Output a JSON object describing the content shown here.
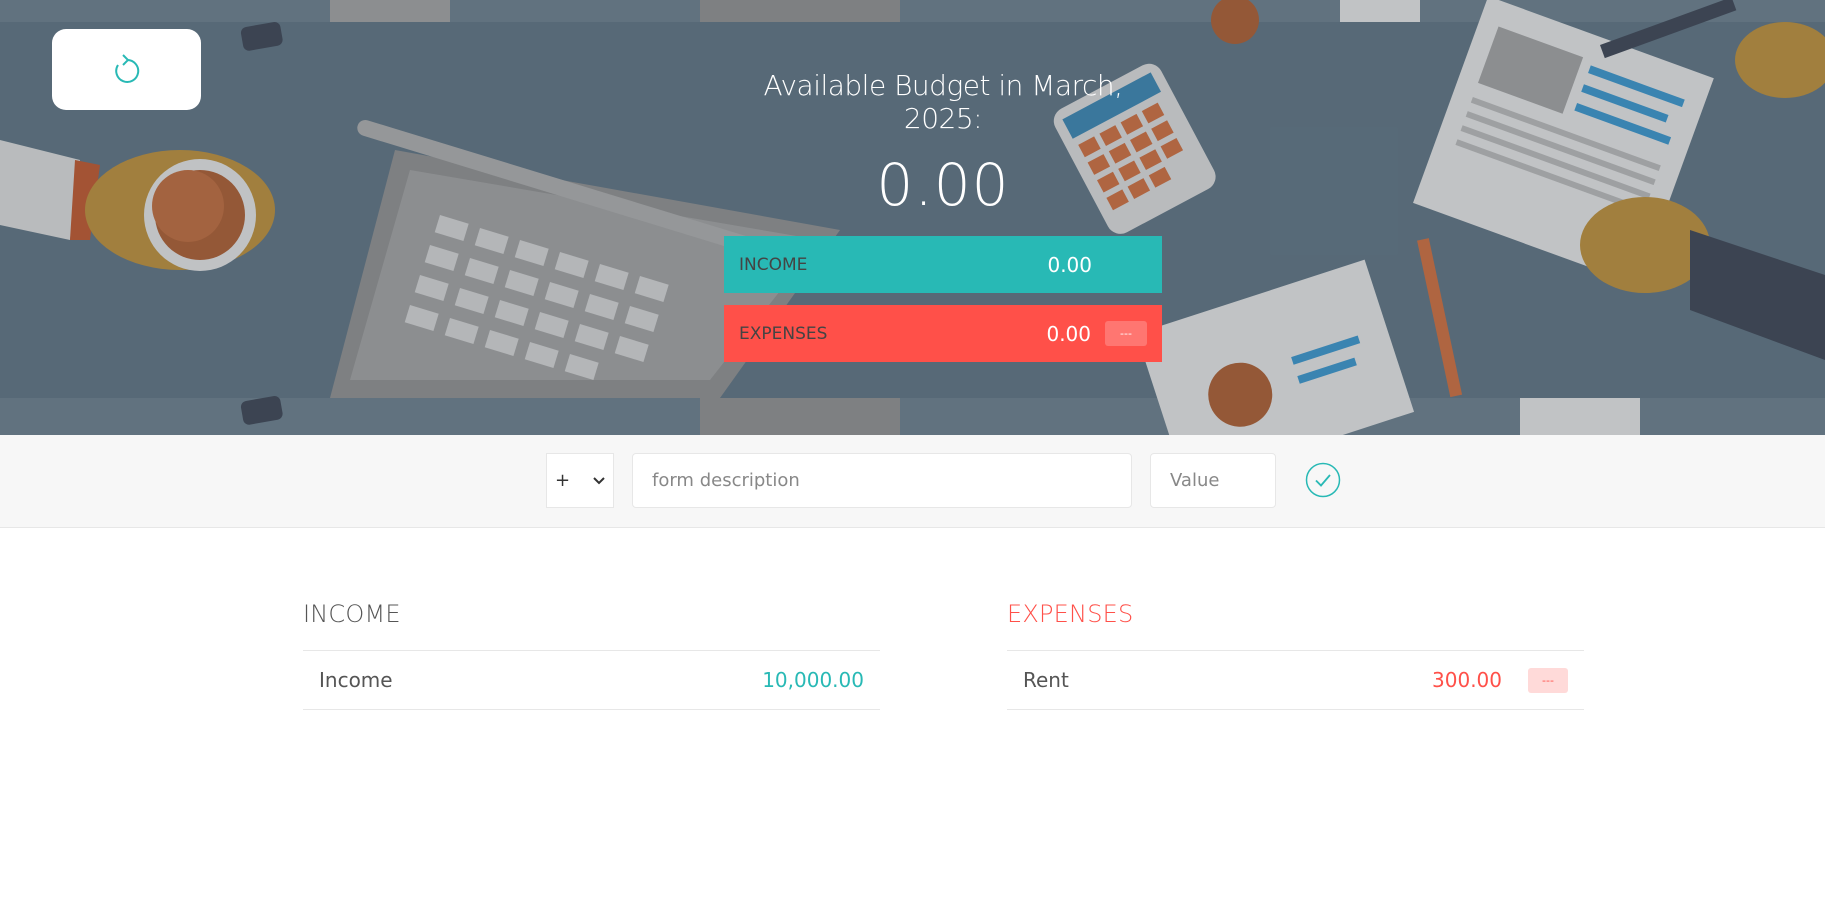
{
  "header": {
    "title": "Available Budget in March, 2025:",
    "budget_value": "0.00",
    "income_label": "INCOME",
    "income_value": "0.00",
    "expenses_label": "EXPENSES",
    "expenses_value": "0.00",
    "expenses_percentage": "---",
    "reload_icon": "reload-icon"
  },
  "form": {
    "type_selected": "+",
    "description_placeholder": "form description",
    "value_placeholder": "Value",
    "submit_icon": "check-circle-icon"
  },
  "income": {
    "title": "INCOME",
    "items": [
      {
        "description": "Income",
        "value": "10,000.00"
      }
    ]
  },
  "expenses": {
    "title": "EXPENSES",
    "items": [
      {
        "description": "Rent",
        "value": "300.00",
        "percentage": "---"
      }
    ]
  },
  "colors": {
    "income": "#28b9b5",
    "expenses": "#ff5049",
    "hero_background": "#5b6f7e"
  }
}
